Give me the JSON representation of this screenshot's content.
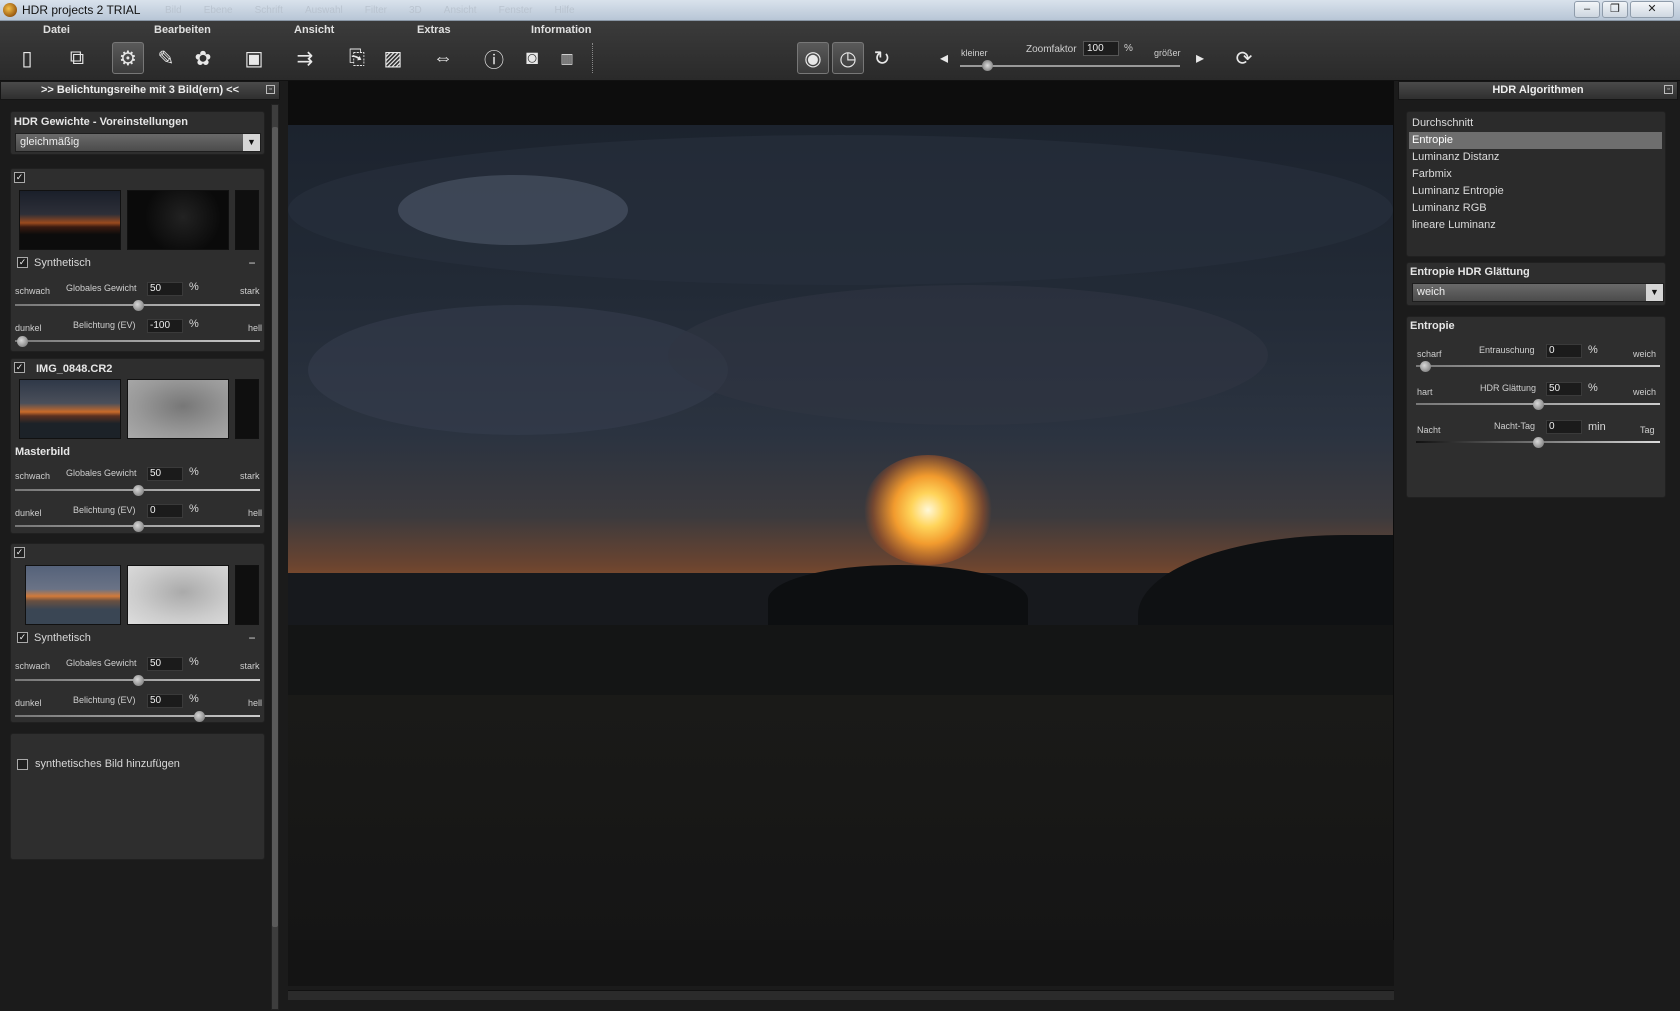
{
  "window": {
    "title": "HDR projects 2  TRIAL",
    "ghost_menu": [
      "Bild",
      "Ebene",
      "Schrift",
      "Auswahl",
      "Filter",
      "3D",
      "Ansicht",
      "Fenster",
      "Hilfe"
    ]
  },
  "menu": {
    "datei": "Datei",
    "bearbeiten": "Bearbeiten",
    "ansicht": "Ansicht",
    "extras": "Extras",
    "information": "Information"
  },
  "zoom": {
    "smaller": "kleiner",
    "label": "Zoomfaktor",
    "value": "100",
    "unit": "%",
    "larger": "größer"
  },
  "left_panel": {
    "header": ">> Belichtungsreihe mit 3 Bild(ern) <<",
    "weights_title": "HDR Gewichte - Voreinstellungen",
    "preset": "gleichmäßig",
    "images": [
      {
        "checked": true,
        "name": "",
        "synthetic_label": "Synthetisch",
        "weight": "50",
        "exposure": "-100",
        "weight_level": 0.5,
        "exposure_level": 0.0
      },
      {
        "checked": true,
        "name": "IMG_0848.CR2",
        "master_label": "Masterbild",
        "weight": "50",
        "exposure": "0",
        "weight_level": 0.5,
        "exposure_level": 0.5
      },
      {
        "checked": true,
        "name": "",
        "synthetic_label": "Synthetisch",
        "weight": "50",
        "exposure": "50",
        "weight_level": 0.5,
        "exposure_level": 0.75
      }
    ],
    "labels": {
      "weak": "schwach",
      "global_weight": "Globales Gewicht",
      "percent": "%",
      "strong": "stark",
      "dark": "dunkel",
      "exposure": "Belichtung (EV)",
      "bright": "hell"
    },
    "add_synthetic": "synthetisches Bild hinzufügen"
  },
  "right_panel": {
    "header": "HDR Algorithmen",
    "algorithms": [
      "Durchschnitt",
      "Entropie",
      "Luminanz Distanz",
      "Farbmix",
      "Luminanz Entropie",
      "Luminanz RGB",
      "lineare Luminanz"
    ],
    "selected": "Entropie",
    "smoothing_title": "Entropie HDR Glättung",
    "smoothing_value": "weich",
    "entropy_title": "Entropie",
    "params": [
      {
        "left": "scharf",
        "label": "Entrauschung",
        "value": "0",
        "unit": "%",
        "right": "weich",
        "level": 0.0
      },
      {
        "left": "hart",
        "label": "HDR Glättung",
        "value": "50",
        "unit": "%",
        "right": "weich",
        "level": 0.5
      },
      {
        "left": "Nacht",
        "label": "Nacht-Tag",
        "value": "0",
        "unit": "min",
        "right": "Tag",
        "level": 0.5
      }
    ]
  },
  "icons": [
    "new-icon",
    "copy-icon",
    "settings-icon",
    "brush-icon",
    "palette-icon",
    "save-icon",
    "export-icon",
    "batch-icon",
    "crop-compare-icon",
    "resize-icon",
    "info-icon",
    "exif-icon",
    "histogram-icon",
    "preview-eye-icon",
    "auto-icon",
    "refresh-icon",
    "rotate-icon"
  ]
}
